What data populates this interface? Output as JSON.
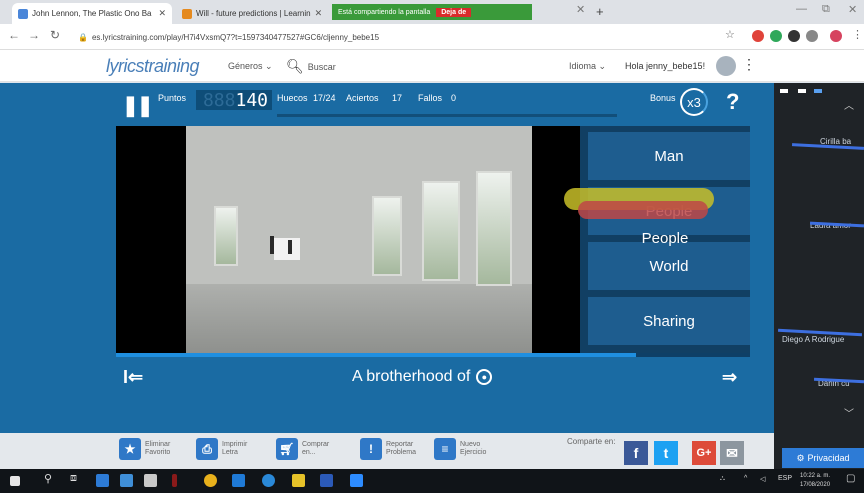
{
  "browser": {
    "tabs": [
      {
        "title": "John Lennon, The Plastic Ono Ba",
        "favicon_color": "#4a86d9"
      },
      {
        "title": "Will - future predictions | Learnin",
        "favicon_color": "#e58a1f"
      }
    ],
    "share_banner": {
      "text": "Está compartiendo la pantalla",
      "stop_label": "Deja de"
    },
    "url": "es.lyricstraining.com/play/H7i4VxsmQ7?t=1597340477527#GC6/cljenny_bebe15"
  },
  "site": {
    "logo": "lyricstraining",
    "nav": {
      "genres": "Géneros ⌄",
      "search": "Buscar"
    },
    "language": "Idioma ⌄",
    "greeting": "Hola jenny_bebe15!"
  },
  "game": {
    "points_label": "Puntos",
    "points_value": "140",
    "points_dim": "888",
    "huecos_label": "Huecos",
    "huecos_value": "17/24",
    "aciertos_label": "Aciertos",
    "aciertos_value": "17",
    "fallos_label": "Fallos",
    "fallos_value": "0",
    "bonus_label": "Bonus",
    "bonus_value": "x3",
    "help": "?",
    "answers": [
      "Man",
      "People",
      "World",
      "Sharing"
    ],
    "lyric": "A brotherhood of",
    "progress": 0.82
  },
  "footer": {
    "tools": [
      {
        "label": "Eliminar Favorito",
        "icon": "star-icon"
      },
      {
        "label": "Imprimir Letra",
        "icon": "print-icon"
      },
      {
        "label": "Comprar en...",
        "icon": "cart-icon"
      },
      {
        "label": "Reportar Problema",
        "icon": "alert-icon"
      },
      {
        "label": "Nuevo Ejercicio",
        "icon": "new-icon"
      }
    ],
    "share_label": "Comparte en:",
    "social": [
      "f",
      "t",
      "G+",
      "✉"
    ]
  },
  "side_panel": {
    "names": [
      "Cirilla ba",
      "Laura amor",
      "Diego A Rodrigue",
      "Darlin cu"
    ],
    "privacy": "Privacidad"
  },
  "taskbar": {
    "time": "10:22 a. m.",
    "date": "17/08/2020",
    "lang": "ESP"
  },
  "colors": {
    "player_bg": "#1a6ba3",
    "answer_bg": "#1e5d8f",
    "accent": "#1f8fe0"
  }
}
